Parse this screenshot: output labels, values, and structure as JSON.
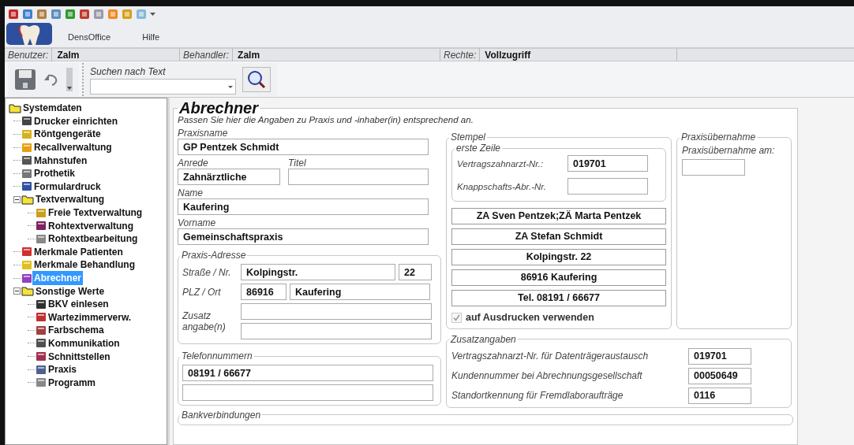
{
  "app_menu": [
    {
      "label": "DensOffice"
    },
    {
      "label": "Hilfe"
    }
  ],
  "info_bar": [
    {
      "label": "Benutzer:",
      "value": "Zalm"
    },
    {
      "label": "Behandler:",
      "value": "Zalm"
    },
    {
      "label": "Rechte:",
      "value": "Vollzugriff"
    }
  ],
  "toolbar": {
    "search": {
      "label": "Suchen nach Text"
    }
  },
  "tree": [
    {
      "label": "Systemdaten",
      "selected": false,
      "children": [
        {
          "label": "Drucker einrichten",
          "selected": false
        },
        {
          "label": "Röntgengeräte",
          "selected": false
        },
        {
          "label": "Recallverwaltung",
          "selected": false
        },
        {
          "label": "Mahnstufen",
          "selected": false
        },
        {
          "label": "Prothetik",
          "selected": false
        },
        {
          "label": "Formulardruck",
          "selected": false
        },
        {
          "label": "Textverwaltung",
          "selected": false,
          "expanded": true,
          "children": [
            {
              "label": "Freie Textverwaltung",
              "selected": false
            },
            {
              "label": "Rohtextverwaltung",
              "selected": false
            },
            {
              "label": "Rohtextbearbeitung",
              "selected": false
            }
          ]
        },
        {
          "label": "Merkmale Patienten",
          "selected": false
        },
        {
          "label": "Merkmale Behandlung",
          "selected": false
        },
        {
          "label": "Abrechner",
          "selected": true
        },
        {
          "label": "Sonstige Werte",
          "selected": false,
          "expanded": true,
          "children": [
            {
              "label": "BKV einlesen",
              "selected": false
            },
            {
              "label": "Wartezimmerverw.",
              "selected": false
            },
            {
              "label": "Farbschema",
              "selected": false
            },
            {
              "label": "Kommunikation",
              "selected": false
            },
            {
              "label": "Schnittstellen",
              "selected": false
            },
            {
              "label": "Praxis",
              "selected": false
            },
            {
              "label": "Programm",
              "selected": false
            }
          ]
        }
      ]
    }
  ],
  "form": {
    "title": "Abrechner",
    "description": "Passen Sie hier die Angaben zu Praxis und -inhaber(in) entsprechend an.",
    "praxisname": {
      "label": "Praxisname",
      "value": "GP Pentzek Schmidt"
    },
    "anrede": {
      "label": "Anrede",
      "value": "Zahnärztliche"
    },
    "titel": {
      "label": "Titel"
    },
    "name": {
      "label": "Name",
      "value": "Kaufering"
    },
    "vorname": {
      "label": "Vorname",
      "value": "Gemeinschaftspraxis"
    },
    "address": {
      "legend": "Praxis-Adresse",
      "street": {
        "label": "Straße / Nr.",
        "value": "Kolpingstr.",
        "number": "22"
      },
      "city": {
        "label": "PLZ / Ort",
        "zip": "86916",
        "value": "Kaufering"
      },
      "extra": {
        "label": "Zusatz angabe(n)"
      }
    },
    "phones": {
      "legend": "Telefonnummern",
      "values": [
        "08191 / 66677"
      ]
    },
    "stamp": {
      "legend": "Stempel",
      "first_line": {
        "legend": "erste Zeile",
        "fields": [
          {
            "label": "Vertragszahnarzt-Nr.:",
            "value": "019701"
          },
          {
            "label": "Knappschafts-Abr.-Nr."
          }
        ]
      },
      "lines": [
        "ZA Sven Pentzek;ZÄ Marta Pentzek",
        "ZA Stefan Schmidt",
        "Kolpingstr. 22",
        "86916 Kaufering",
        "Tel. 08191 / 66677"
      ],
      "use_on_print": {
        "label": "auf Ausdrucken verwenden",
        "checked": true,
        "disabled": true
      }
    },
    "takeover": {
      "legend": "Praxisübernahme",
      "label": "Praxisübernahme am:"
    },
    "extra_info": {
      "legend": "Zusatzangaben",
      "rows": [
        {
          "label": "Vertragszahnarzt-Nr. für Datenträgeraustausch",
          "value": "019701"
        },
        {
          "label": "Kundennummer bei Abrechnungsgesellschaft",
          "value": "00050649"
        },
        {
          "label": "Standortkennung für Fremdlaboraufträge",
          "value": "0116"
        }
      ]
    },
    "bank": {
      "legend": "Bankverbindungen"
    }
  }
}
